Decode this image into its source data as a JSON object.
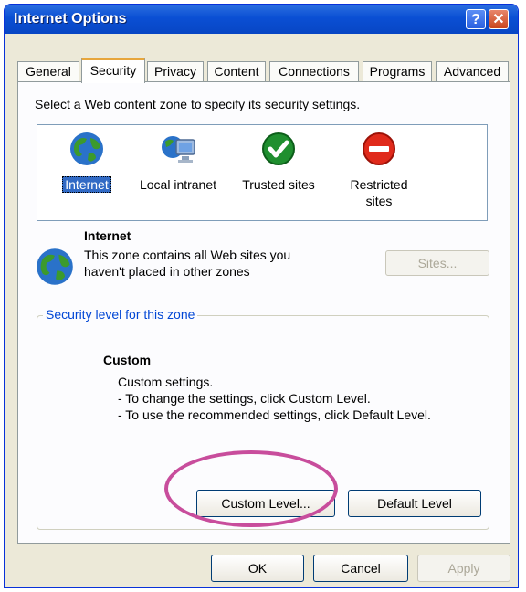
{
  "window": {
    "title": "Internet Options"
  },
  "titlebar_buttons": {
    "help": "?",
    "close": "✕"
  },
  "tabs": [
    {
      "label": "General"
    },
    {
      "label": "Security",
      "active": true
    },
    {
      "label": "Privacy"
    },
    {
      "label": "Content"
    },
    {
      "label": "Connections"
    },
    {
      "label": "Programs"
    },
    {
      "label": "Advanced"
    }
  ],
  "security": {
    "instruction": "Select a Web content zone to specify its security settings.",
    "zones": [
      {
        "label": "Internet",
        "icon": "globe-icon",
        "selected": true
      },
      {
        "label": "Local intranet",
        "icon": "network-computer-icon"
      },
      {
        "label": "Trusted sites",
        "icon": "green-checkmark-icon"
      },
      {
        "label": "Restricted sites",
        "label_line1": "Restricted",
        "label_line2": "sites",
        "icon": "red-no-entry-icon"
      }
    ],
    "selected_zone": {
      "name": "Internet",
      "description_line1": "This zone contains all Web sites you",
      "description_line2": "haven't placed in other zones",
      "sites_button": "Sites..."
    },
    "level_group": {
      "legend": "Security level for this zone",
      "level_name": "Custom",
      "lines": [
        "Custom settings.",
        "- To change the settings, click Custom Level.",
        "- To use the recommended settings, click Default Level."
      ],
      "custom_level_button": "Custom Level...",
      "default_level_button": "Default Level"
    }
  },
  "footer": {
    "ok": "OK",
    "cancel": "Cancel",
    "apply": "Apply"
  },
  "colors": {
    "titlebar": "#0a4fd4",
    "highlight": "#316ac5",
    "annotation_oval": "#c84d9c",
    "group_legend": "#0046d5"
  }
}
